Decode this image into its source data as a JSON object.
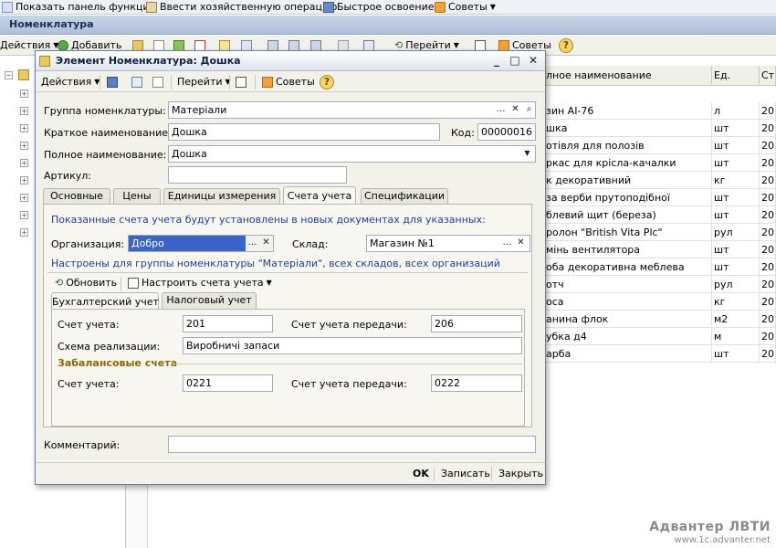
{
  "top_toolbar": {
    "items": [
      "Показать панель функций",
      "Ввести хозяйственную операцию",
      "Быстрое освоение",
      "Советы"
    ]
  },
  "background_window": {
    "title": "Номенклатура",
    "toolbar": {
      "actions_label": "Действия",
      "add_label": "Добавить",
      "goto_label": "Перейти",
      "tips_label": "Советы"
    },
    "grid": {
      "columns": [
        "лное наименование",
        "Ед.",
        "Ст"
      ],
      "rows": [
        {
          "name": "зин АІ-76",
          "unit": "л",
          "st": "20"
        },
        {
          "name": "шка",
          "unit": "шт",
          "st": "20"
        },
        {
          "name": "отівля для полозів",
          "unit": "шт",
          "st": "20"
        },
        {
          "name": "ркас для крісла-качалки",
          "unit": "шт",
          "st": "20"
        },
        {
          "name": "к декоративний",
          "unit": "кг",
          "st": "20"
        },
        {
          "name": "за верби прутоподібної",
          "unit": "шт",
          "st": "20"
        },
        {
          "name": "блевий щит (береза)",
          "unit": "шт",
          "st": "20"
        },
        {
          "name": "ролон \"British Vita Plc\"",
          "unit": "рул",
          "st": "20"
        },
        {
          "name": "мінь вентилятора",
          "unit": "шт",
          "st": "20"
        },
        {
          "name": "оба декоративна меблева",
          "unit": "шт",
          "st": "20"
        },
        {
          "name": "отч",
          "unit": "рул",
          "st": "20"
        },
        {
          "name": "оса",
          "unit": "кг",
          "st": "20"
        },
        {
          "name": "анина флок",
          "unit": "м2",
          "st": "20"
        },
        {
          "name": "убка д4",
          "unit": "м",
          "st": "20"
        },
        {
          "name": "арба",
          "unit": "шт",
          "st": "20"
        }
      ]
    }
  },
  "dialog": {
    "title": "Элемент Номенклатура: Дошка",
    "toolbar": {
      "actions_label": "Действия",
      "goto_label": "Перейти",
      "tips_label": "Советы"
    },
    "fields": {
      "group_label": "Группа номенклатуры:",
      "group_value": "Матеріали",
      "short_name_label": "Краткое наименование:",
      "short_name_value": "Дошка",
      "code_label": "Код:",
      "code_value": "00000016",
      "full_name_label": "Полное наименование:",
      "full_name_value": "Дошка",
      "article_label": "Артикул:",
      "article_value": ""
    },
    "tabs": [
      "Основные",
      "Цены",
      "Единицы измерения",
      "Счета учета",
      "Спецификации"
    ],
    "active_tab": "Счета учета",
    "accounts_tab": {
      "note1": "Показанные счета учета будут установлены в новых документах для указанных:",
      "org_label": "Организация:",
      "org_value": "Добро",
      "warehouse_label": "Склад:",
      "warehouse_value": "Магазин №1",
      "note2": "Настроены для группы номенклатуры \"Матеріали\", всех складов, всех организаций",
      "refresh_label": "Обновить",
      "configure_label": "Настроить счета учета",
      "subtabs": [
        "Бухгалтерский учет",
        "Налоговый учет"
      ],
      "account_label": "Счет учета:",
      "account_value": "201",
      "transfer_label": "Счет учета передачи:",
      "transfer_value": "206",
      "scheme_label": "Схема реализации:",
      "scheme_value": "Виробничі запаси",
      "offbalance_title": "Забалансовые счета",
      "off_account_label": "Счет учета:",
      "off_account_value": "0221",
      "off_transfer_label": "Счет учета передачи:",
      "off_transfer_value": "0222"
    },
    "comment_label": "Комментарий:",
    "comment_value": "",
    "buttons": {
      "ok": "OK",
      "save": "Записать",
      "close": "Закрыть"
    }
  },
  "watermark": {
    "line1": "Адвантер ЛВТИ",
    "line2": "www.1c.advanter.net"
  }
}
